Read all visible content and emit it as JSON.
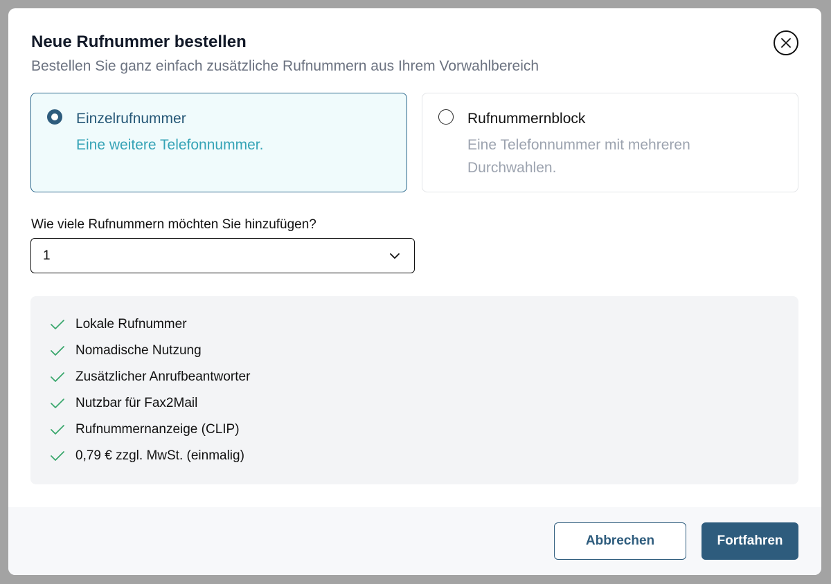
{
  "modal": {
    "title": "Neue Rufnummer bestellen",
    "subtitle": "Bestellen Sie ganz einfach zusätzliche Rufnummern aus Ihrem Vorwahlbereich"
  },
  "options": [
    {
      "title": "Einzelrufnummer",
      "description": "Eine weitere Telefonnummer.",
      "selected": true
    },
    {
      "title": "Rufnummernblock",
      "description": "Eine Telefonnummer mit mehreren Durchwahlen.",
      "selected": false
    }
  ],
  "quantity": {
    "label": "Wie viele Rufnummern möchten Sie hinzufügen?",
    "value": "1"
  },
  "features": [
    "Lokale Rufnummer",
    "Nomadische Nutzung",
    "Zusätzlicher Anrufbeantworter",
    "Nutzbar für Fax2Mail",
    "Rufnummernanzeige (CLIP)",
    "0,79 € zzgl. MwSt. (einmalig)"
  ],
  "footer": {
    "cancel_label": "Abbrechen",
    "continue_label": "Fortfahren"
  },
  "colors": {
    "primary": "#2e5c7d",
    "selected_bg": "#f0fbfc",
    "accent_text": "#35a3b6",
    "check": "#3aa76d"
  },
  "icons": {
    "close": "close-icon",
    "chevron": "chevron-down-icon",
    "check": "check-icon"
  }
}
